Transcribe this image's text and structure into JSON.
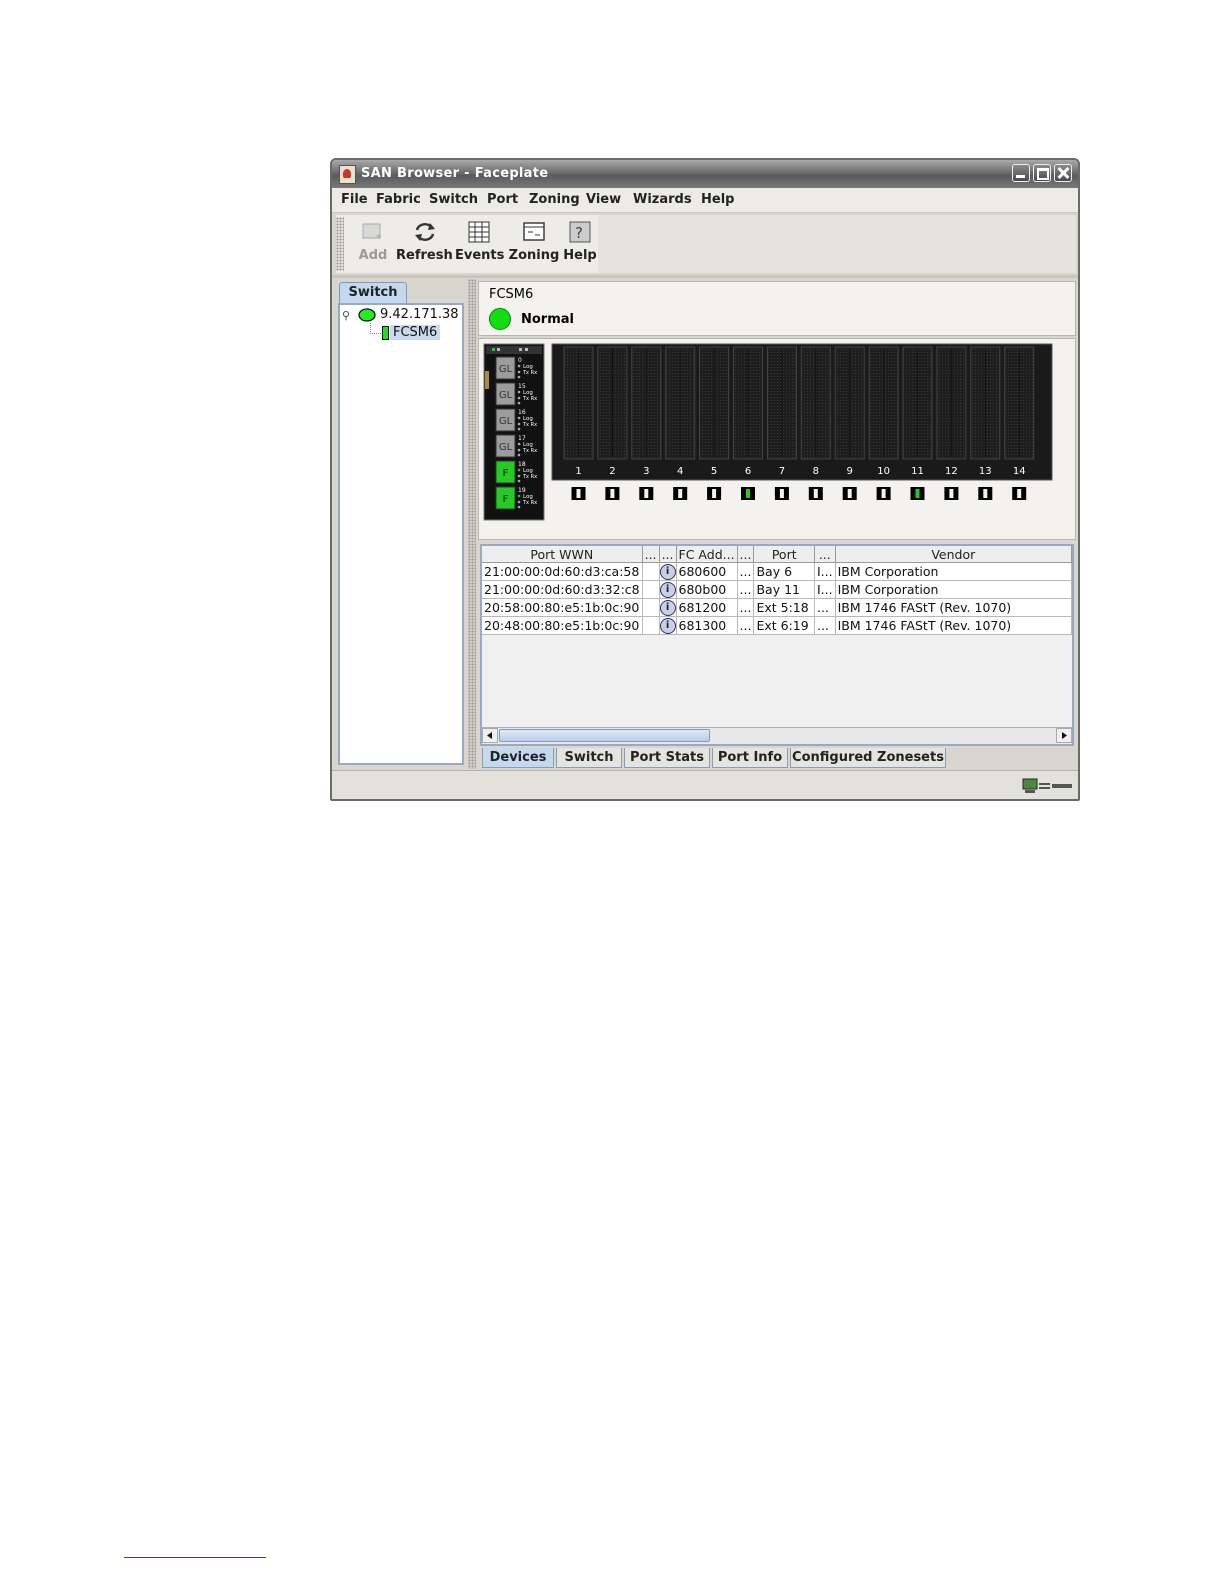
{
  "window": {
    "title": "SAN Browser - Faceplate"
  },
  "menu": [
    "File",
    "Fabric",
    "Switch",
    "Port",
    "Zoning",
    "View",
    "Wizards",
    "Help"
  ],
  "toolbar": {
    "add": "Add",
    "refresh": "Refresh",
    "events": "Events",
    "zoning": "Zoning",
    "help": "Help"
  },
  "left_panel": {
    "tab": "Switch",
    "tree_root": "9.42.171.38",
    "tree_child": "FCSM6"
  },
  "switch_status": {
    "name": "FCSM6",
    "status": "Normal",
    "status_color": "#11dd11"
  },
  "faceplate": {
    "module_ports": [
      {
        "type": "GL",
        "number": "0",
        "state": "inactive"
      },
      {
        "type": "GL",
        "number": "15",
        "state": "inactive"
      },
      {
        "type": "GL",
        "number": "16",
        "state": "inactive"
      },
      {
        "type": "GL",
        "number": "17",
        "state": "inactive"
      },
      {
        "type": "F",
        "number": "18",
        "state": "active"
      },
      {
        "type": "F",
        "number": "19",
        "state": "active"
      }
    ],
    "port_led_labels": [
      "Log",
      "Tx Rx"
    ],
    "bays": [
      "1",
      "2",
      "3",
      "4",
      "5",
      "6",
      "7",
      "8",
      "9",
      "10",
      "11",
      "12",
      "13",
      "14"
    ],
    "active_bays": [
      "6",
      "11"
    ],
    "active_color": "#22cc22"
  },
  "devices_table": {
    "headers": [
      "Port WWN",
      "...",
      "...",
      "FC Add...",
      "...",
      "Port",
      "...",
      "Vendor"
    ],
    "rows": [
      [
        "21:00:00:0d:60:d3:ca:58",
        "",
        "i",
        "680600",
        "...",
        "Bay 6",
        "I...",
        "IBM Corporation"
      ],
      [
        "21:00:00:0d:60:d3:32:c8",
        "",
        "i",
        "680b00",
        "...",
        "Bay 11",
        "I...",
        "IBM Corporation"
      ],
      [
        "20:58:00:80:e5:1b:0c:90",
        "",
        "i",
        "681200",
        "...",
        "Ext 5:18",
        "...",
        "IBM      1746      FAStT  (Rev. 1070)"
      ],
      [
        "20:48:00:80:e5:1b:0c:90",
        "",
        "i",
        "681300",
        "...",
        "Ext 6:19",
        "...",
        "IBM      1746      FAStT  (Rev. 1070)"
      ]
    ]
  },
  "bottom_tabs": [
    {
      "label": "Devices",
      "active": true
    },
    {
      "label": "Switch",
      "active": false
    },
    {
      "label": "Port Stats",
      "active": false
    },
    {
      "label": "Port Info",
      "active": false
    },
    {
      "label": "Configured Zonesets",
      "active": false
    }
  ]
}
